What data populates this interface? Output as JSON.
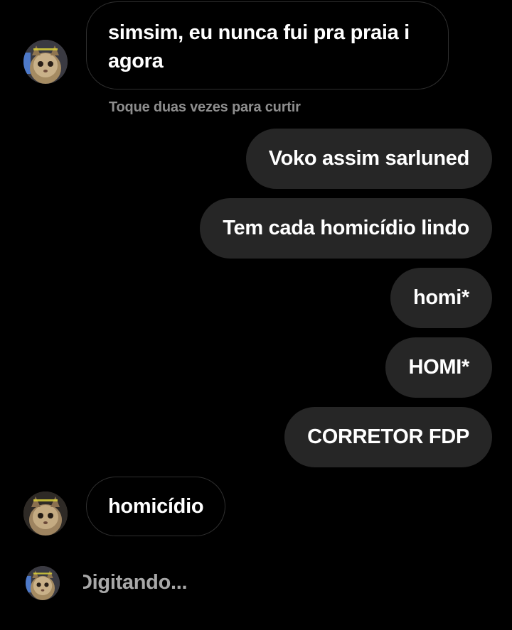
{
  "colors": {
    "background": "#000000",
    "sent_bubble": "#262626",
    "received_border": "#2f2f2f",
    "hint_text": "#8e8e8e"
  },
  "messages": [
    {
      "id": 1,
      "direction": "received",
      "lines": [
        "simsim, eu nunca fui pra praia i",
        "agora"
      ]
    },
    {
      "id": 2,
      "direction": "sent",
      "text": "Voko assim sarluned"
    },
    {
      "id": 3,
      "direction": "sent",
      "text": "Tem cada homicídio lindo"
    },
    {
      "id": 4,
      "direction": "sent",
      "text": "homi*"
    },
    {
      "id": 5,
      "direction": "sent",
      "text": "HOMI*"
    },
    {
      "id": 6,
      "direction": "sent",
      "text": "CORRETOR FDP"
    },
    {
      "id": 7,
      "direction": "received",
      "text": "homicídio"
    }
  ],
  "like_hint": "Toque duas vezes para curtir",
  "typing_indicator": "Digitando...",
  "avatar": {
    "icon": "cat-avatar-icon",
    "caption": "gatinho"
  }
}
